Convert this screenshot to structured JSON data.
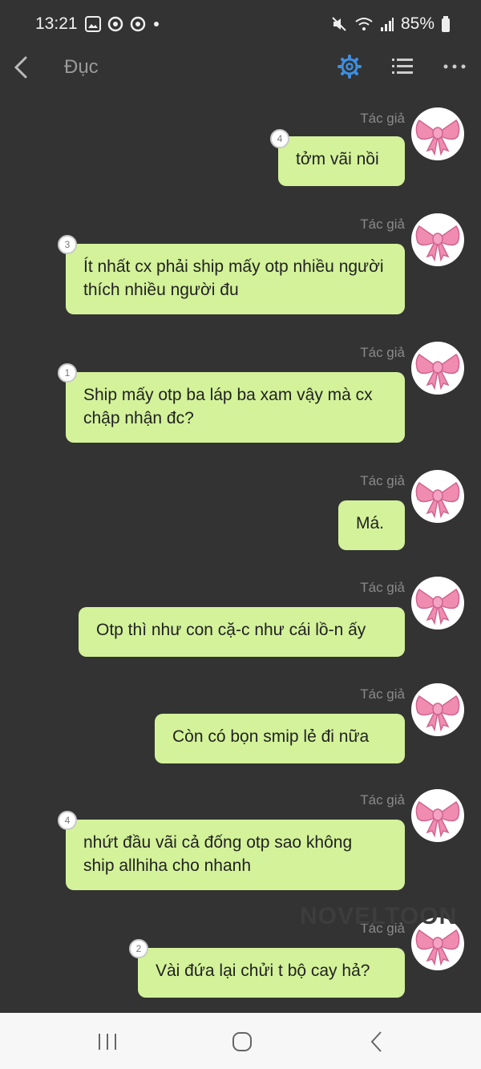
{
  "status_bar": {
    "time": "13:21",
    "battery": "85%",
    "icons": [
      "gallery-icon",
      "chrome-icon",
      "chrome-icon",
      "dot-icon",
      "mute-icon",
      "wifi-icon",
      "signal-icon",
      "battery-icon"
    ]
  },
  "header": {
    "title": "Đục",
    "accent_color": "#3d8fe0"
  },
  "author_label": "Tác giả",
  "messages": [
    {
      "text": "tởm vãi nồi",
      "comments": "4"
    },
    {
      "text": "Ít nhất cx phải ship mấy otp nhiều người thích nhiều người đu",
      "comments": "3"
    },
    {
      "text": "Ship mấy otp ba láp ba xam vậy mà cx chập nhận đc?",
      "comments": "1"
    },
    {
      "text": "Má.",
      "comments": ""
    },
    {
      "text": "Otp thì như con cặ-c như cái lồ-n ấy",
      "comments": ""
    },
    {
      "text": "Còn có bọn smip lẻ đi nữa",
      "comments": ""
    },
    {
      "text": "nhứt đầu vãi cả đống otp sao không ship allhiha cho nhanh",
      "comments": "4"
    },
    {
      "text": "Vài đứa lại chửi t bộ cay hả?",
      "comments": "2"
    }
  ],
  "watermark": "NOVELTOON",
  "colors": {
    "background": "#333333",
    "bubble": "#d3f29a",
    "avatar_bow": "#f08cb0"
  }
}
